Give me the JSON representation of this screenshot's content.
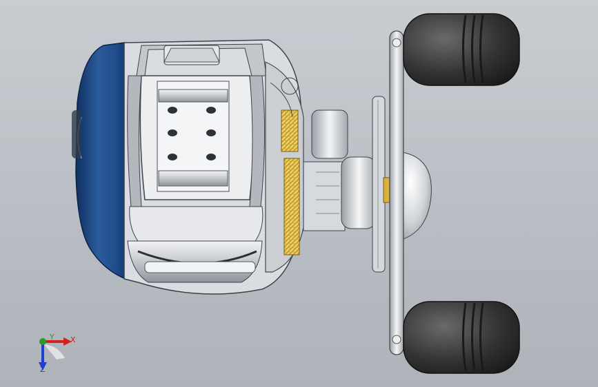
{
  "viewport": {
    "background_top": "#c9cdd2",
    "background_bottom": "#aeb3b9"
  },
  "model": {
    "name": "baitcasting-fishing-reel",
    "colors": {
      "side_plate": "#1f4e8c",
      "frame": "#c9ccd0",
      "gear": "#d8b23a",
      "knob": "#3a3a3a",
      "handle": "#d6d8db"
    }
  },
  "triad": {
    "x_label": "X",
    "y_label": "Y",
    "z_label": "Z",
    "x_color": "#d02020",
    "y_color": "#2a9a2a",
    "z_color": "#1f3fd0"
  }
}
